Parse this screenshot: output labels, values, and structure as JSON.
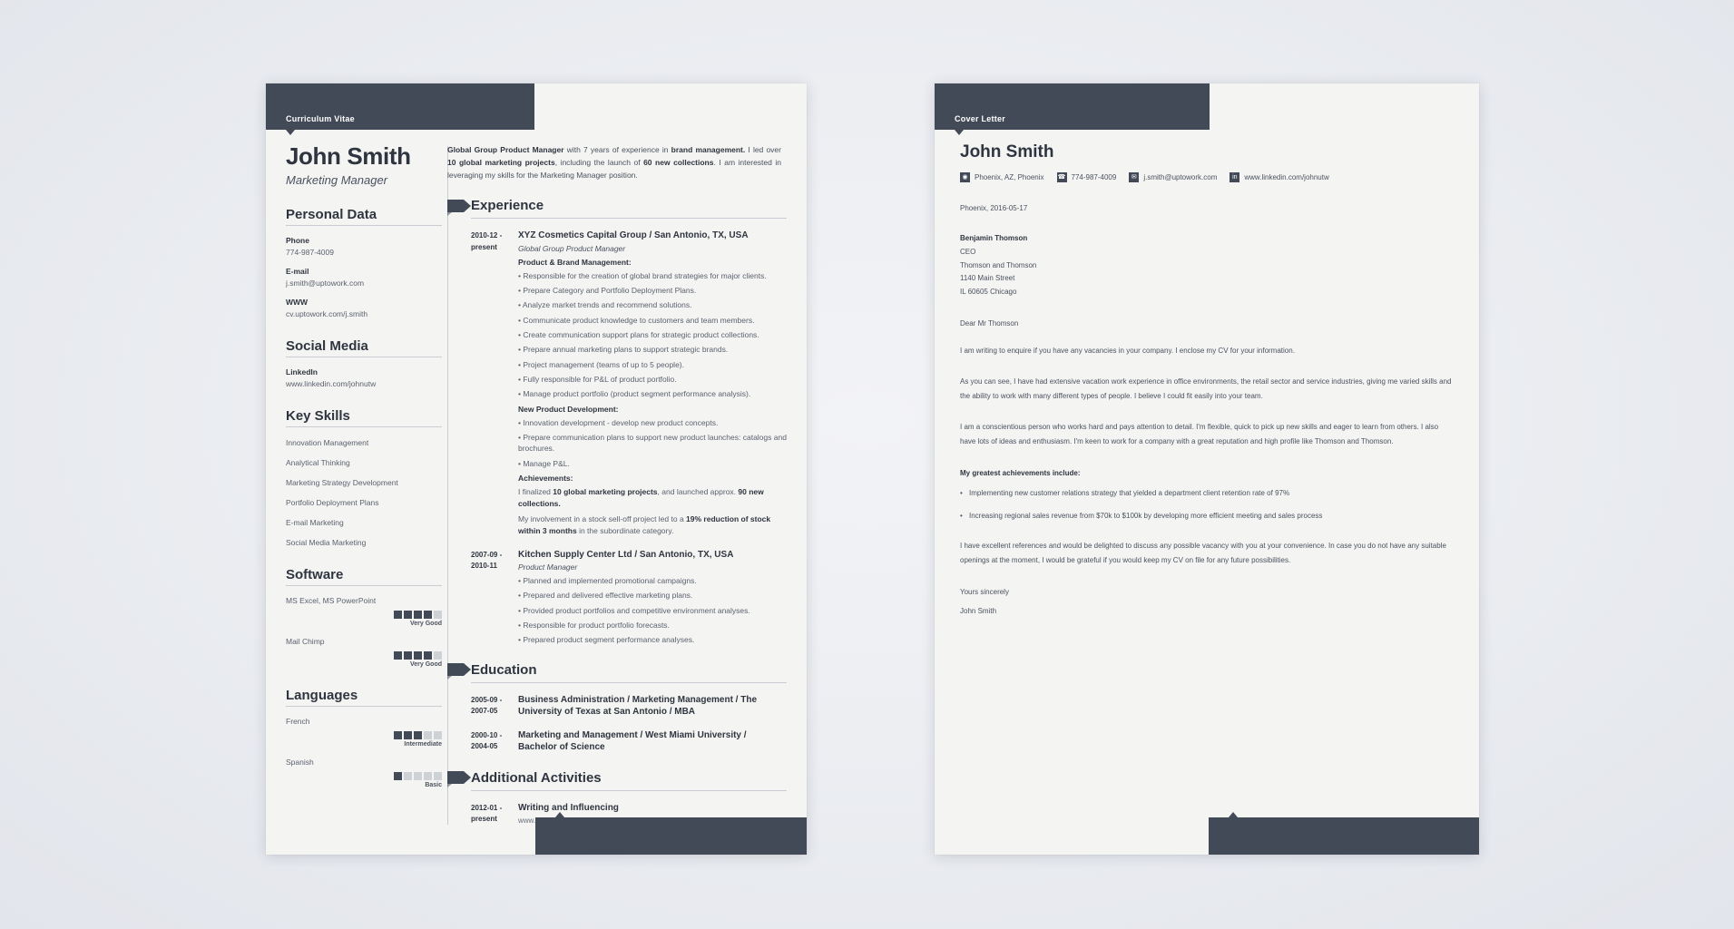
{
  "cv": {
    "kicker": "Curriculum Vitae",
    "name": "John Smith",
    "job_title": "Marketing Manager",
    "summary_html": "<b>Global Group Product Manager</b> with 7 years of experience in <b>brand management.</b> I led over <b>10 global marketing projects</b>, including the launch of <b>60 new collections</b>. I am interested in leveraging my skills for the Marketing Manager position.",
    "personal_data": {
      "title": "Personal Data",
      "fields": [
        {
          "label": "Phone",
          "value": "774-987-4009"
        },
        {
          "label": "E-mail",
          "value": "j.smith@uptowork.com"
        },
        {
          "label": "WWW",
          "value": "cv.uptowork.com/j.smith"
        }
      ]
    },
    "social_media": {
      "title": "Social Media",
      "fields": [
        {
          "label": "LinkedIn",
          "value": "www.linkedin.com/johnutw"
        }
      ]
    },
    "key_skills": {
      "title": "Key Skills",
      "items": [
        "Innovation Management",
        "Analytical Thinking",
        "Marketing Strategy Development",
        "Portfolio Deployment Plans",
        "E-mail Marketing",
        "Social Media Marketing"
      ]
    },
    "software": {
      "title": "Software",
      "items": [
        {
          "name": "MS Excel, MS PowerPoint",
          "filled": 4,
          "total": 5,
          "level": "Very Good"
        },
        {
          "name": "Mail Chimp",
          "filled": 4,
          "total": 5,
          "level": "Very Good"
        }
      ]
    },
    "languages": {
      "title": "Languages",
      "items": [
        {
          "name": "French",
          "filled": 3,
          "total": 5,
          "level": "Intermediate"
        },
        {
          "name": "Spanish",
          "filled": 1,
          "total": 5,
          "level": "Basic"
        }
      ]
    },
    "experience": {
      "title": "Experience",
      "entries": [
        {
          "date": "2010-12 - present",
          "org": "XYZ Cosmetics Capital Group / San Antonio, TX, USA",
          "role": "Global Group Product Manager",
          "blocks": [
            {
              "type": "sub",
              "text": "Product & Brand Management:"
            },
            {
              "type": "bullet",
              "text": "Responsible for the creation of global brand strategies for major clients."
            },
            {
              "type": "bullet",
              "text": "Prepare Category and Portfolio Deployment Plans."
            },
            {
              "type": "bullet",
              "text": "Analyze market trends and recommend solutions."
            },
            {
              "type": "bullet",
              "text": "Communicate product knowledge to customers and team members."
            },
            {
              "type": "bullet",
              "text": "Create communication support plans for strategic product collections."
            },
            {
              "type": "bullet",
              "text": "Prepare annual marketing plans to support strategic brands."
            },
            {
              "type": "bullet",
              "text": "Project management (teams of up to 5 people)."
            },
            {
              "type": "bullet",
              "text": "Fully responsible for P&L of product portfolio."
            },
            {
              "type": "bullet",
              "text": "Manage product portfolio (product segment performance analysis)."
            },
            {
              "type": "sub",
              "text": "New Product Development:"
            },
            {
              "type": "bullet",
              "text": "Innovation development - develop new product concepts."
            },
            {
              "type": "bullet",
              "text": "Prepare communication plans to support new product launches: catalogs and brochures."
            },
            {
              "type": "bullet",
              "text": "Manage P&L."
            },
            {
              "type": "sub",
              "text": "Achievements:"
            },
            {
              "type": "para",
              "html": "I finalized <b>10 global marketing projects</b>, and launched approx. <b>90 new collections.</b>"
            },
            {
              "type": "para",
              "html": "My involvement in a stock sell-off project led to a <b>19% reduction of stock within 3 months</b> in the subordinate category."
            }
          ]
        },
        {
          "date": "2007-09 - 2010-11",
          "org": "Kitchen Supply Center Ltd / San Antonio, TX, USA",
          "role": "Product Manager",
          "blocks": [
            {
              "type": "bullet",
              "text": "Planned and implemented promotional campaigns."
            },
            {
              "type": "bullet",
              "text": "Prepared and delivered effective marketing plans."
            },
            {
              "type": "bullet",
              "text": "Provided product portfolios and competitive environment analyses."
            },
            {
              "type": "bullet",
              "text": "Responsible for product portfolio forecasts."
            },
            {
              "type": "bullet",
              "text": "Prepared product segment performance analyses."
            }
          ]
        }
      ]
    },
    "education": {
      "title": "Education",
      "entries": [
        {
          "date": "2005-09 - 2007-05",
          "org": "Business Administration / Marketing Management / The University of Texas at San Antonio / MBA"
        },
        {
          "date": "2000-10 - 2004-05",
          "org": "Marketing and Management / West Miami University / Bachelor of Science"
        }
      ]
    },
    "additional": {
      "title": "Additional Activities",
      "entries": [
        {
          "date": "2012-01 - present",
          "org": "Writing and Influencing",
          "link": "www.mymarketingcampaings.me"
        }
      ]
    }
  },
  "cover_letter": {
    "kicker": "Cover Letter",
    "name": "John Smith",
    "contacts": [
      {
        "icon": "location-pin-icon",
        "glyph": "◉",
        "text": "Phoenix, AZ, Phoenix"
      },
      {
        "icon": "phone-icon",
        "glyph": "☎",
        "text": "774-987-4009"
      },
      {
        "icon": "envelope-icon",
        "glyph": "✉",
        "text": "j.smith@uptowork.com"
      },
      {
        "icon": "linkedin-icon",
        "glyph": "in",
        "text": "www.linkedin.com/johnutw"
      }
    ],
    "date_line": "Phoenix, 2016-05-17",
    "recipient": {
      "name": "Benjamin Thomson",
      "title": "CEO",
      "company": "Thomson and Thomson",
      "street": "1140 Main Street",
      "city": "IL 60605 Chicago"
    },
    "salutation": "Dear Mr Thomson",
    "paragraphs": [
      "I am writing to enquire if you have any vacancies in your company. I enclose my CV for your information.",
      "As you can see, I have had extensive vacation work experience in office environments, the retail sector and service industries, giving me varied skills and the ability to work with many different types of people. I believe I could fit easily into your team.",
      "I am a conscientious person who works hard and pays attention to detail. I'm flexible, quick to pick up new skills and eager to learn from others. I also have lots of ideas and enthusiasm. I'm keen to work for a company with a great reputation and high profile like Thomson and Thomson."
    ],
    "achievements_heading": "My greatest achievements include:",
    "achievements": [
      "Implementing new customer relations strategy that yielded a department client retention rate of 97%",
      "Increasing regional sales revenue from $70k to $100k by developing more efficient meeting and sales process"
    ],
    "closing_paragraph": "I have excellent references and would be delighted to discuss any possible vacancy with you at your convenience. In case you do not have any suitable openings at the moment, I would be grateful if you would keep my CV on file for any future possibilities.",
    "sign_off": "Yours sincerely",
    "signature": "John Smith"
  },
  "theme": {
    "dark": "#434a57",
    "paper": "#f4f4f2",
    "text": "#2f3540",
    "muted": "#5b6170",
    "rule": "#c9ccd2"
  }
}
